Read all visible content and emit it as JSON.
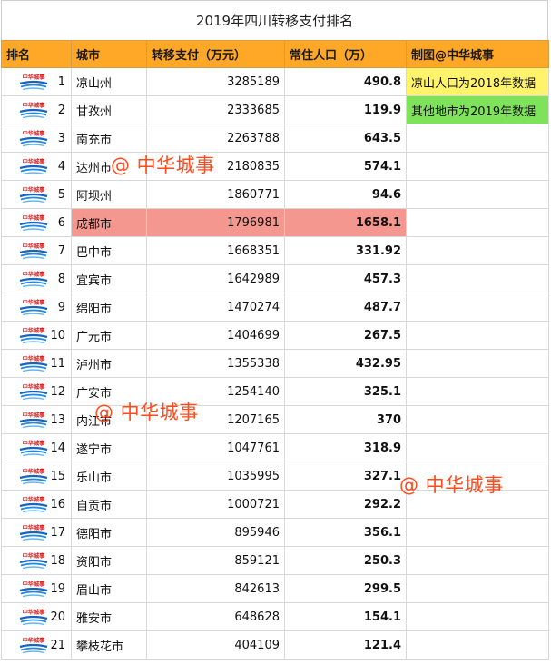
{
  "title": "2019年四川转移支付排名",
  "headers": {
    "rank": "排名",
    "city": "城市",
    "payment": "转移支付（万元）",
    "population": "常住人口（万）",
    "note": "制图@中华城事"
  },
  "logo_text": "中华城事",
  "watermark_text": "@ 中华城事",
  "rows": [
    {
      "rank": "1",
      "city": "凉山州",
      "payment": "3285189",
      "population": "490.8",
      "note": "凉山人口为2018年数据"
    },
    {
      "rank": "2",
      "city": "甘孜州",
      "payment": "2333685",
      "population": "119.9",
      "note": "其他地市为2019年数据"
    },
    {
      "rank": "3",
      "city": "南充市",
      "payment": "2263788",
      "population": "643.5",
      "note": ""
    },
    {
      "rank": "4",
      "city": "达州市",
      "payment": "2180835",
      "population": "574.1",
      "note": ""
    },
    {
      "rank": "5",
      "city": "阿坝州",
      "payment": "1860771",
      "population": "94.6",
      "note": ""
    },
    {
      "rank": "6",
      "city": "成都市",
      "payment": "1796981",
      "population": "1658.1",
      "note": ""
    },
    {
      "rank": "7",
      "city": "巴中市",
      "payment": "1668351",
      "population": "331.92",
      "note": ""
    },
    {
      "rank": "8",
      "city": "宜宾市",
      "payment": "1642989",
      "population": "457.3",
      "note": ""
    },
    {
      "rank": "9",
      "city": "绵阳市",
      "payment": "1470274",
      "population": "487.7",
      "note": ""
    },
    {
      "rank": "10",
      "city": "广元市",
      "payment": "1404699",
      "population": "267.5",
      "note": ""
    },
    {
      "rank": "11",
      "city": "泸州市",
      "payment": "1355338",
      "population": "432.95",
      "note": ""
    },
    {
      "rank": "12",
      "city": "广安市",
      "payment": "1254140",
      "population": "325.1",
      "note": ""
    },
    {
      "rank": "13",
      "city": "内江市",
      "payment": "1207165",
      "population": "370",
      "note": ""
    },
    {
      "rank": "14",
      "city": "遂宁市",
      "payment": "1047761",
      "population": "318.9",
      "note": ""
    },
    {
      "rank": "15",
      "city": "乐山市",
      "payment": "1035995",
      "population": "327.1",
      "note": ""
    },
    {
      "rank": "16",
      "city": "自贡市",
      "payment": "1000721",
      "population": "292.2",
      "note": ""
    },
    {
      "rank": "17",
      "city": "德阳市",
      "payment": "895946",
      "population": "356.1",
      "note": ""
    },
    {
      "rank": "18",
      "city": "资阳市",
      "payment": "859121",
      "population": "250.3",
      "note": ""
    },
    {
      "rank": "19",
      "city": "眉山市",
      "payment": "842613",
      "population": "299.5",
      "note": ""
    },
    {
      "rank": "20",
      "city": "雅安市",
      "payment": "648628",
      "population": "154.1",
      "note": ""
    },
    {
      "rank": "21",
      "city": "攀枝花市",
      "payment": "404109",
      "population": "121.4",
      "note": ""
    }
  ],
  "highlight_rank": "6",
  "colors": {
    "header": "#ffa726",
    "highlight_row": "#f4978e",
    "note_yellow": "#fff36b",
    "note_green": "#7ee35b",
    "watermark": "#ff4a1c"
  }
}
